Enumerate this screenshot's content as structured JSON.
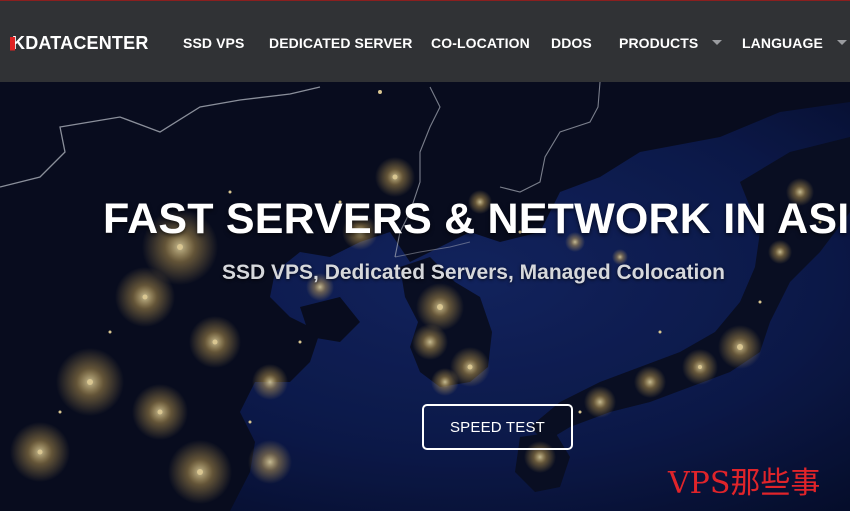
{
  "brand": {
    "name": "KDATACENTER"
  },
  "nav": {
    "items": [
      {
        "label": "SSD VPS"
      },
      {
        "label": "DEDICATED SERVER"
      },
      {
        "label": "CO-LOCATION"
      },
      {
        "label": "DDOS"
      },
      {
        "label": "PRODUCTS",
        "has_dropdown": true
      },
      {
        "label": "LANGUAGE",
        "has_dropdown": true
      }
    ]
  },
  "hero": {
    "title": "FAST SERVERS & NETWORK IN ASIA",
    "subtitle": "SSD VPS, Dedicated Servers, Managed Colocation",
    "cta_label": "SPEED TEST"
  },
  "watermark": {
    "text": "VPS那些事"
  },
  "colors": {
    "navbar_bg": "#303235",
    "accent_red": "#e02424",
    "ocean": "#0d1a4a",
    "city_lights": "#ffd98a"
  }
}
